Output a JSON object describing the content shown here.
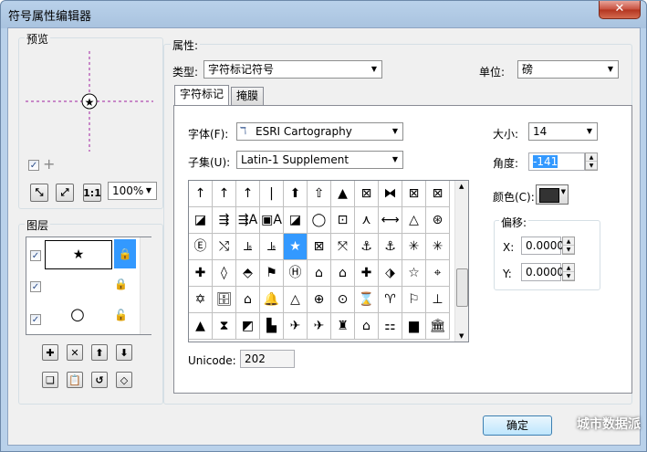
{
  "window": {
    "title": "符号属性编辑器",
    "close_glyph": "✕"
  },
  "preview": {
    "label": "预览",
    "zoom": "100%",
    "tool_buttons": [
      "fit-all",
      "full-extent",
      "one-to-one"
    ]
  },
  "layers": {
    "label": "图层",
    "items": [
      {
        "checked": true,
        "symbol": "★",
        "selected": true
      },
      {
        "checked": true,
        "symbol": "",
        "selected": false
      },
      {
        "checked": true,
        "symbol": "○",
        "selected": false
      }
    ],
    "action_buttons": [
      "add-layer",
      "remove-layer",
      "move-up",
      "move-down"
    ],
    "tool_buttons": [
      "copy",
      "paste",
      "clear",
      "tag"
    ]
  },
  "properties": {
    "label": "属性:",
    "type_label": "类型:",
    "type_value": "字符标记符号",
    "unit_label": "单位:",
    "unit_value": "磅",
    "tabs": [
      "字符标记",
      "掩膜"
    ],
    "font_label": "字体(F):",
    "font_value": "ESRI Cartography",
    "subset_label": "子集(U):",
    "subset_value": "Latin-1 Supplement",
    "size_label": "大小:",
    "size_value": "14",
    "angle_label": "角度:",
    "angle_value": "-141",
    "color_label": "颜色(C):",
    "color_value": "#333333",
    "offset_label": "偏移:",
    "offset_x_label": "X:",
    "offset_x_value": "0.0000",
    "offset_y_label": "Y:",
    "offset_y_value": "0.0000",
    "unicode_label": "Unicode:",
    "unicode_value": "202"
  },
  "glyph_grid": {
    "rows": [
      [
        "↑",
        "↑",
        "↑",
        "|",
        "⬆",
        "⇧",
        "▲",
        "⊠",
        "⧓",
        "⊠",
        "⊠"
      ],
      [
        "◪",
        "⇶",
        "⇶A",
        "▣A",
        "◪",
        "◯",
        "⊡",
        "⋏",
        "⟷",
        "△",
        "⊛"
      ],
      [
        "Ⓔ",
        "⤭",
        "⫡",
        "⫡",
        "★",
        "⊠",
        "⤧",
        "⚓",
        "⚓",
        "✳",
        "✳"
      ],
      [
        "✚",
        "◊",
        "⬘",
        "⚑",
        "Ⓗ",
        "⌂",
        "⌂",
        "✚",
        "⬗",
        "☆",
        "⌖"
      ],
      [
        "✡",
        "🗄",
        "⌂",
        "🔔",
        "△",
        "⊕",
        "⊙",
        "⌛",
        "♈",
        "⚐",
        "⊥"
      ],
      [
        "▲",
        "⧗",
        "◩",
        "▙",
        "✈",
        "✈",
        "♜",
        "⌂",
        "⚏",
        "▆",
        "🏛"
      ]
    ],
    "selected_row": 2,
    "selected_col": 4
  },
  "footer": {
    "ok_label": "确定",
    "watermark": "城市数据派"
  }
}
